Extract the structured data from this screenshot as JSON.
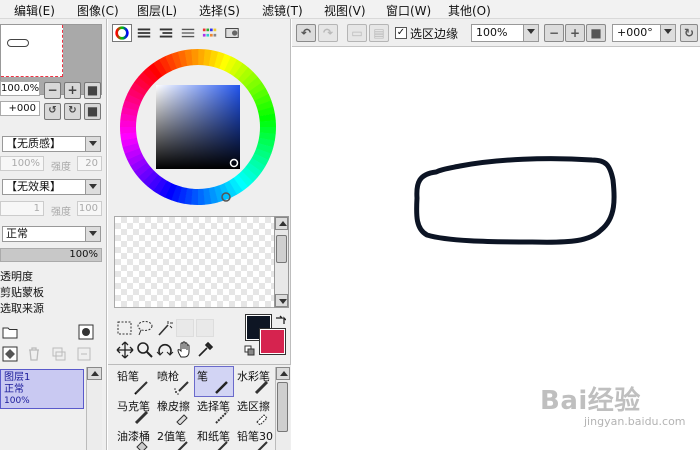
{
  "menu": [
    "编辑(E)",
    "图像(C)",
    "图层(L)",
    "选择(S)",
    "滤镜(T)",
    "视图(V)",
    "窗口(W)",
    "其他(O)"
  ],
  "navigator": {
    "zoom": "100.0%",
    "angle": "+000"
  },
  "brush_texture": {
    "paper": "【无质感】",
    "paper_pct": "100%",
    "paper_strength_label": "强度",
    "paper_strength": "20",
    "effect": "【无效果】",
    "effect_val": "1",
    "effect_strength_label": "强度",
    "effect_strength": "100"
  },
  "layer_panel": {
    "blend_mode": "正常",
    "opacity": "100%",
    "options": [
      "透明度",
      "剪贴蒙板",
      "选取来源"
    ],
    "layer": {
      "name": "图层1",
      "mode": "正常",
      "opacity": "100%"
    }
  },
  "colors": {
    "primary": "#0e1624",
    "secondary": "#d6234f"
  },
  "brushes": [
    [
      "铅笔",
      "喷枪",
      "笔",
      "水彩笔"
    ],
    [
      "马克笔",
      "橡皮擦",
      "选择笔",
      "选区擦"
    ],
    [
      "油漆桶",
      "2值笔",
      "和纸笔",
      "铅笔30"
    ]
  ],
  "active_brush": "笔",
  "canvas_toolbar": {
    "selection_edge_label": "选区边缘",
    "selection_edge_checked": "✓",
    "zoom": "100%",
    "rotation": "+000°"
  },
  "watermark": {
    "brand": "Bai经验",
    "url": "jingyan.baidu.com"
  }
}
